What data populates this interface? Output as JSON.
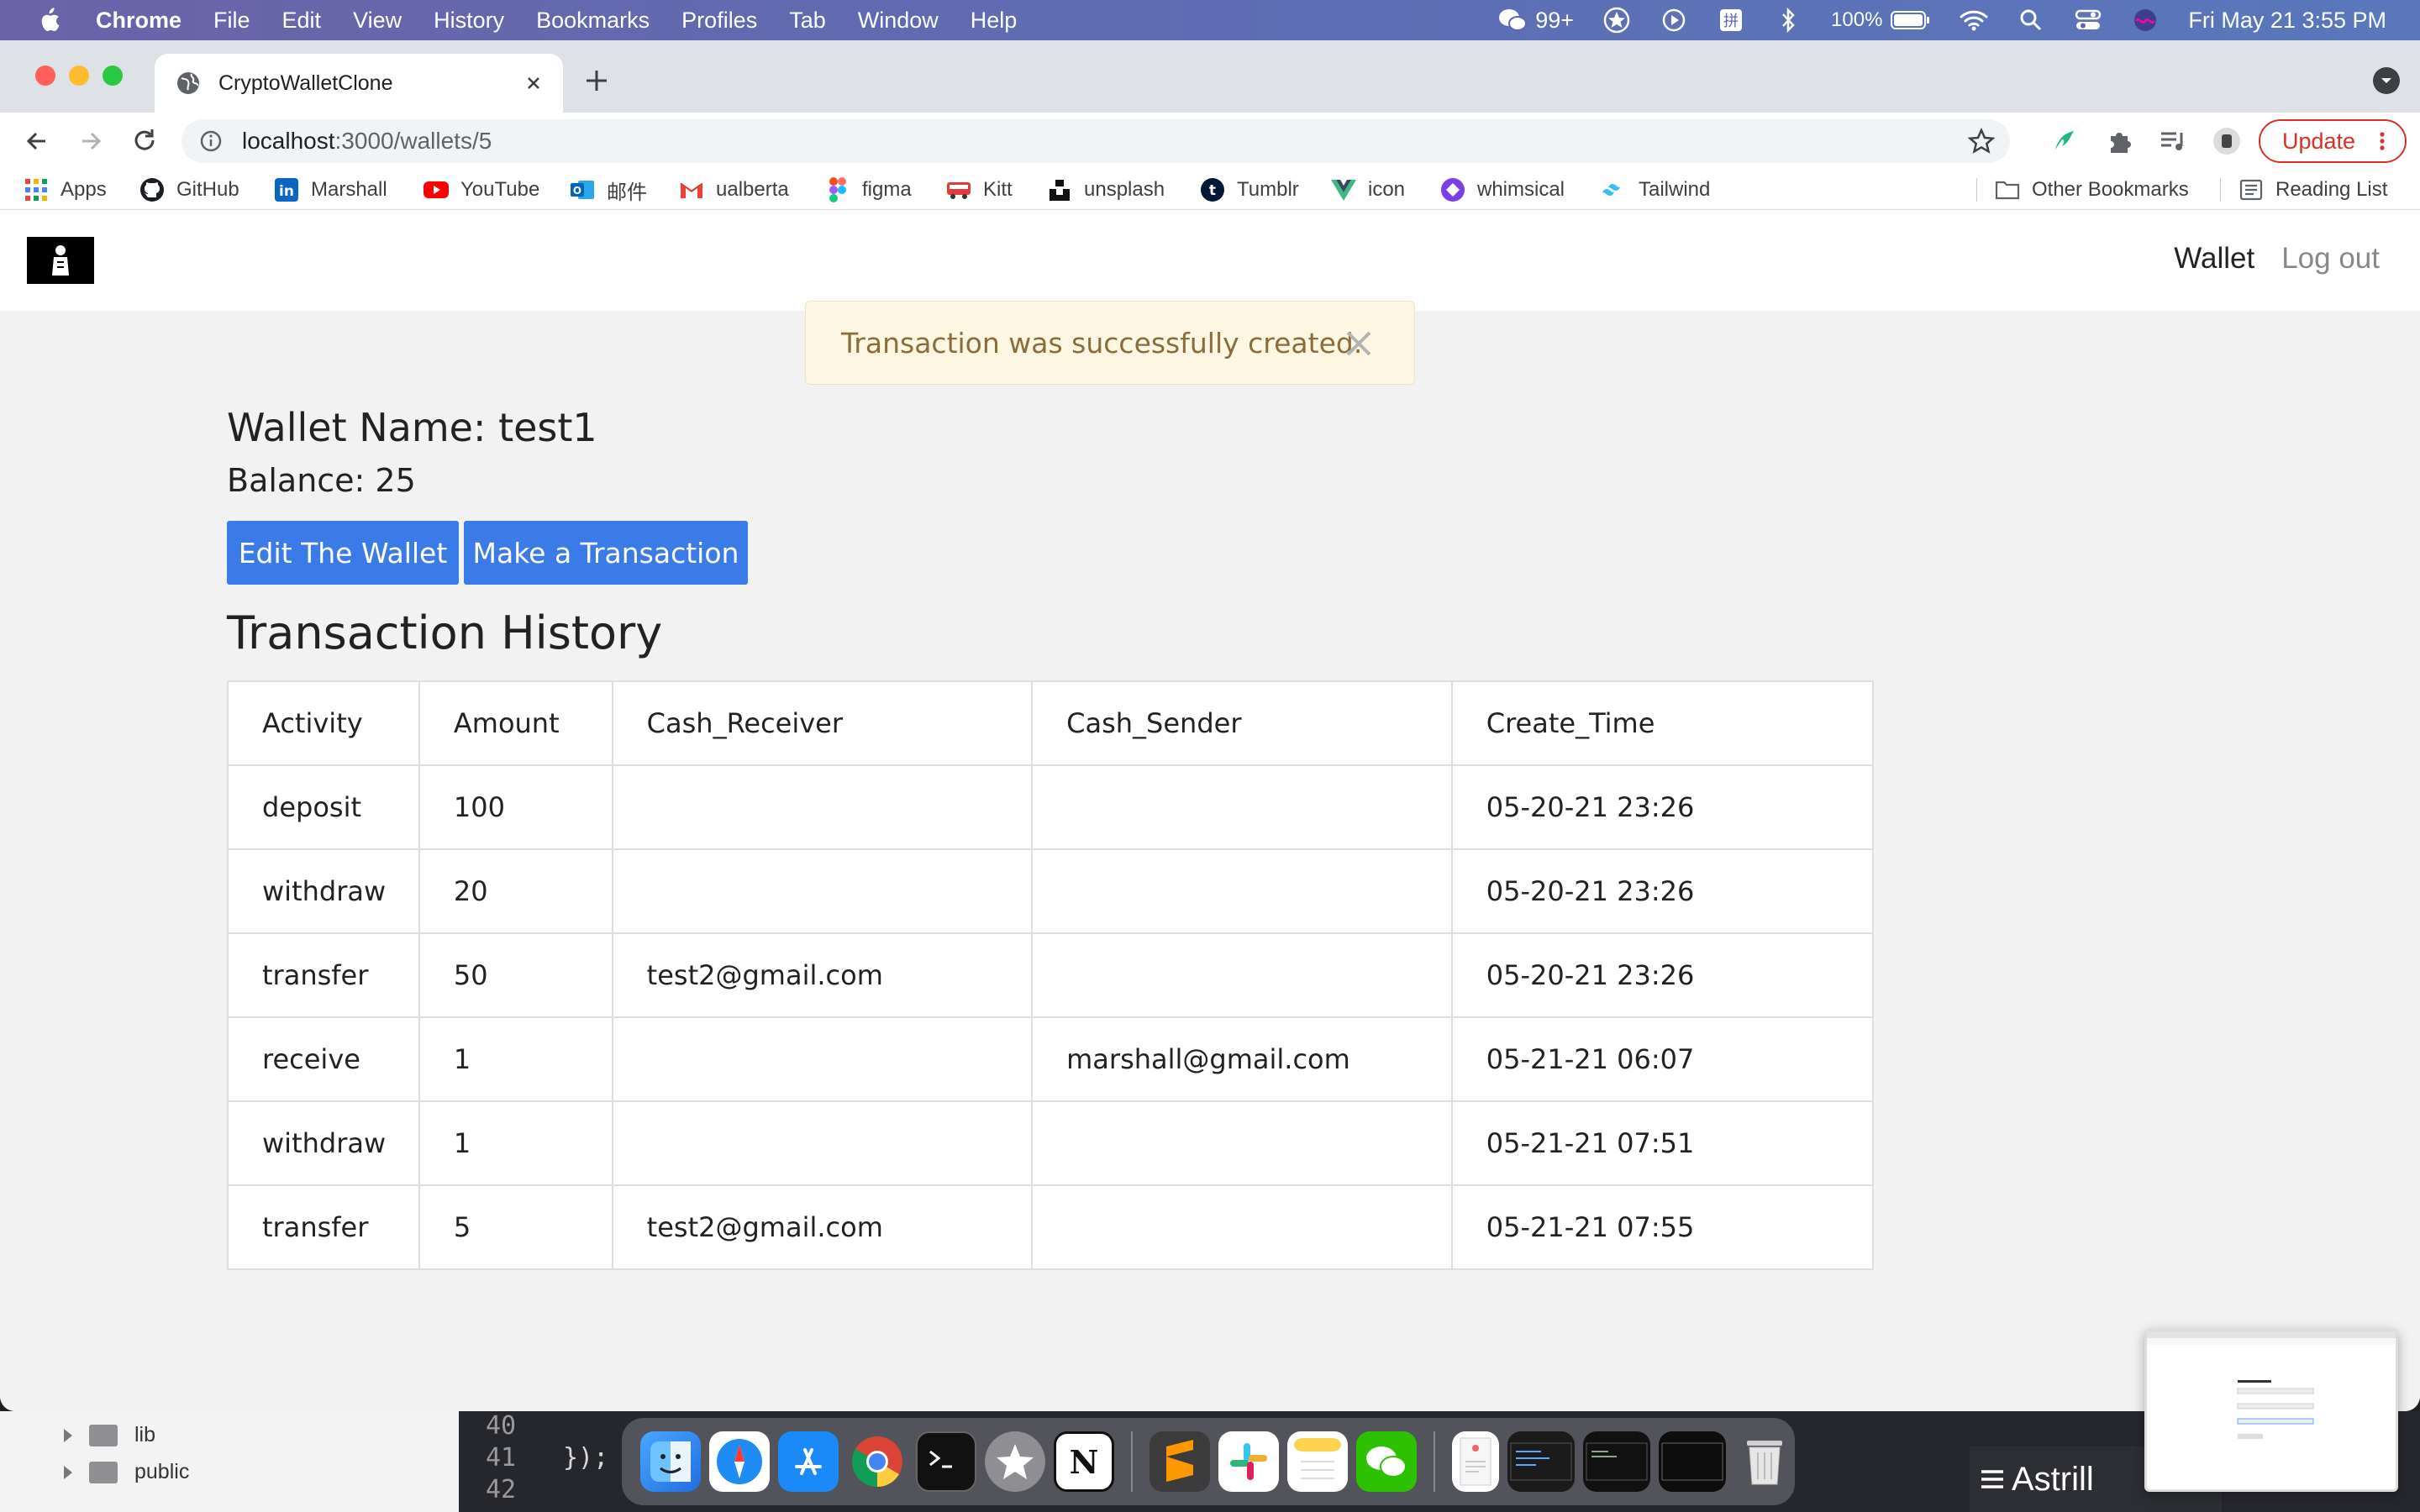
{
  "menubar": {
    "app_name": "Chrome",
    "menus": [
      "File",
      "Edit",
      "View",
      "History",
      "Bookmarks",
      "Profiles",
      "Tab",
      "Window",
      "Help"
    ],
    "wechat_badge": "99+",
    "battery": "100%",
    "datetime": "Fri May 21  3:55 PM"
  },
  "browser": {
    "tab_title": "CryptoWalletClone",
    "url_host": "localhost",
    "url_path": ":3000/wallets/5",
    "update_label": "Update",
    "bookmarks": [
      "Apps",
      "GitHub",
      "Marshall",
      "YouTube",
      "邮件",
      "ualberta",
      "figma",
      "Kitt",
      "unsplash",
      "Tumblr",
      "icon",
      "whimsical",
      "Tailwind"
    ],
    "other_bookmarks": "Other Bookmarks",
    "reading_list": "Reading List"
  },
  "site": {
    "nav": {
      "wallet": "Wallet",
      "logout": "Log out"
    },
    "flash": "Transaction was successfully created.",
    "wallet_name": "Wallet Name: test1",
    "balance": "Balance: 25",
    "edit_button": "Edit The Wallet",
    "transaction_button": "Make a Transaction",
    "history_title": "Transaction History",
    "table": {
      "headers": [
        "Activity",
        "Amount",
        "Cash_Receiver",
        "Cash_Sender",
        "Create_Time"
      ],
      "rows": [
        [
          "deposit",
          "100",
          "",
          "",
          "05-20-21 23:26"
        ],
        [
          "withdraw",
          "20",
          "",
          "",
          "05-20-21 23:26"
        ],
        [
          "transfer",
          "50",
          "test2@gmail.com",
          "",
          "05-20-21 23:26"
        ],
        [
          "receive",
          "1",
          "",
          "marshall@gmail.com",
          "05-21-21 06:07"
        ],
        [
          "withdraw",
          "1",
          "",
          "",
          "05-21-21 07:51"
        ],
        [
          "transfer",
          "5",
          "test2@gmail.com",
          "",
          "05-21-21 07:55"
        ]
      ]
    }
  },
  "background": {
    "tree": [
      "lib",
      "public"
    ],
    "line_numbers": [
      "40",
      "41",
      "42"
    ],
    "code_line": "});",
    "astrill": "Astrill"
  }
}
